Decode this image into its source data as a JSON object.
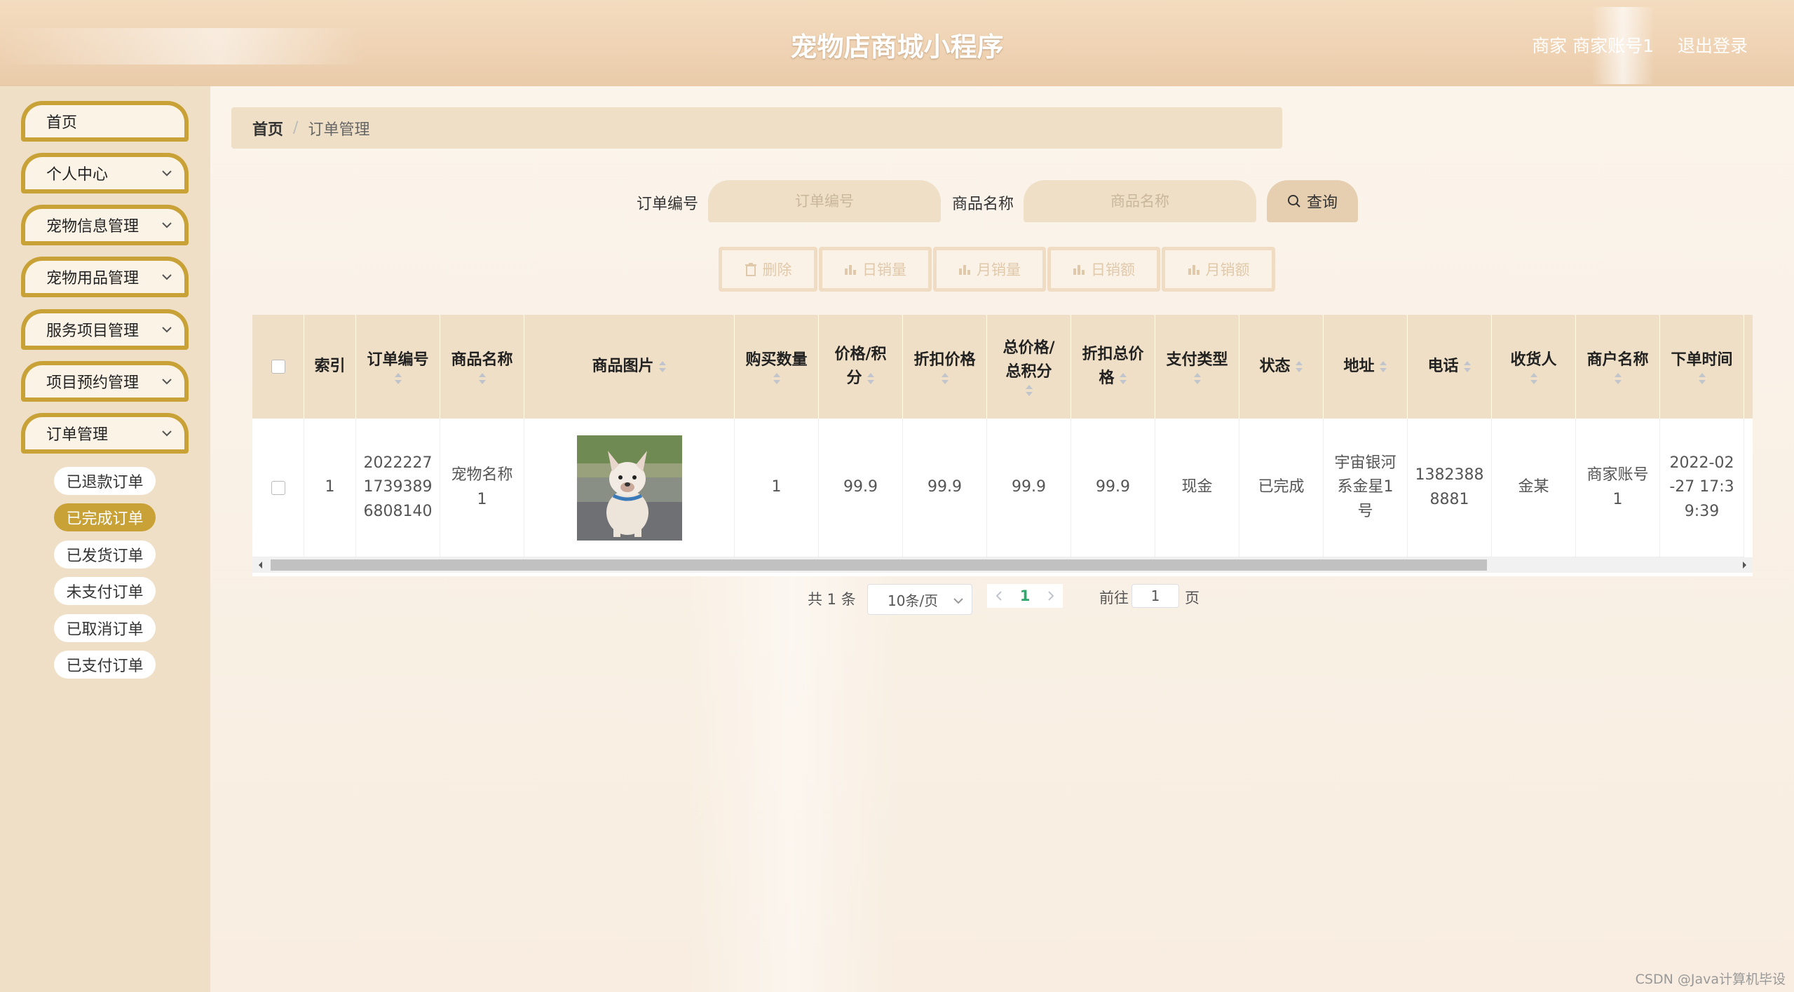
{
  "header": {
    "title": "宠物店商城小程序",
    "user_info": "商家 商家账号1",
    "logout": "退出登录"
  },
  "sidebar": {
    "items": [
      {
        "label": "首页"
      },
      {
        "label": "个人中心"
      },
      {
        "label": "宠物信息管理"
      },
      {
        "label": "宠物用品管理"
      },
      {
        "label": "服务项目管理"
      },
      {
        "label": "项目预约管理"
      },
      {
        "label": "订单管理"
      }
    ],
    "subitems": [
      {
        "label": "已退款订单",
        "active": false
      },
      {
        "label": "已完成订单",
        "active": true
      },
      {
        "label": "已发货订单",
        "active": false
      },
      {
        "label": "未支付订单",
        "active": false
      },
      {
        "label": "已取消订单",
        "active": false
      },
      {
        "label": "已支付订单",
        "active": false
      }
    ]
  },
  "breadcrumb": {
    "home": "首页",
    "separator": "/",
    "current": "订单管理"
  },
  "search": {
    "order_no_label": "订单编号",
    "order_no_placeholder": "订单编号",
    "product_name_label": "商品名称",
    "product_name_placeholder": "商品名称",
    "query_button": "查询"
  },
  "actions": {
    "delete": "删除",
    "daily_sales_qty": "日销量",
    "monthly_sales_qty": "月销量",
    "daily_sales_amount": "日销额",
    "monthly_sales_amount": "月销额"
  },
  "table": {
    "headers": {
      "index": "索引",
      "order_no": "订单编号",
      "product_name": "商品名称",
      "product_image": "商品图片",
      "quantity": "购买数量",
      "price_line1": "价格/积",
      "price_line2": "分",
      "discount_price": "折扣价格",
      "total_line1": "总价格/",
      "total_line2": "总积分",
      "discount_total_line1": "折扣总价",
      "discount_total_line2": "格",
      "pay_type": "支付类型",
      "status": "状态",
      "address": "地址",
      "phone": "电话",
      "receiver": "收货人",
      "merchant": "商户名称",
      "order_time": "下单时间"
    },
    "rows": [
      {
        "index": "1",
        "order_no_1": "2022227",
        "order_no_2": "1739389",
        "order_no_3": "6808140",
        "product_name_1": "宠物名称",
        "product_name_2": "1",
        "quantity": "1",
        "price": "99.9",
        "discount_price": "99.9",
        "total": "99.9",
        "discount_total": "99.9",
        "pay_type": "现金",
        "status": "已完成",
        "address_1": "宇宙银河",
        "address_2": "系金星1",
        "address_3": "号",
        "phone_1": "1382388",
        "phone_2": "8881",
        "receiver": "金某",
        "merchant_1": "商家账号",
        "merchant_2": "1",
        "order_time_1": "2022-02",
        "order_time_2": "-27 17:3",
        "order_time_3": "9:39"
      }
    ]
  },
  "pagination": {
    "total": "共 1 条",
    "page_size": "10条/页",
    "current_page": "1",
    "goto_label": "前往",
    "goto_value": "1",
    "page_suffix": "页"
  },
  "watermark": "CSDN @Java计算机毕设",
  "colors": {
    "accent": "#c9a237",
    "header_bg": "#efd3b4",
    "sidebar_bg": "#efdfc6",
    "table_header_bg": "#efdfc6",
    "active_page": "#2fa86b"
  }
}
